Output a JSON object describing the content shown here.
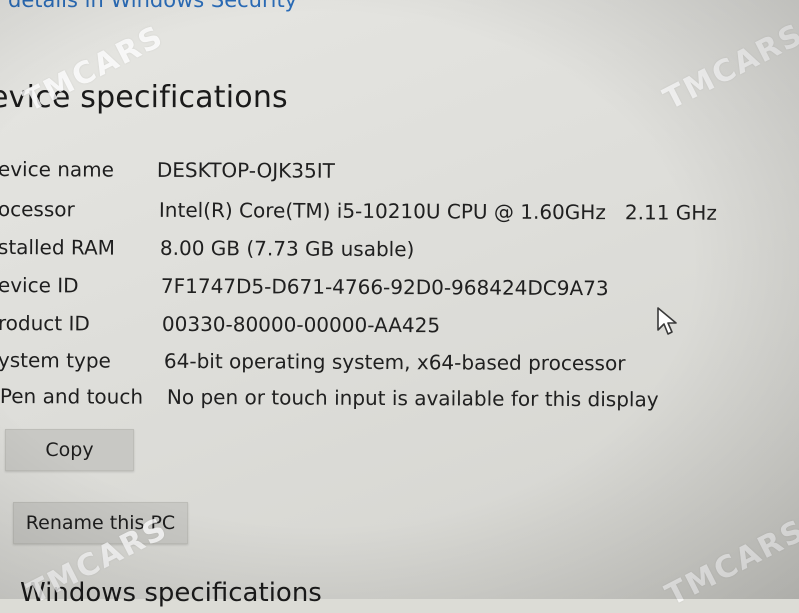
{
  "header": {
    "security_link": "details in Windows Security",
    "section_title": "evice specifications",
    "next_section_title": "Windows specifications"
  },
  "specs": [
    {
      "label": "evice name",
      "value": "DESKTOP-OJK35IT"
    },
    {
      "label": "ocessor",
      "value": "Intel(R) Core(TM) i5-10210U CPU @ 1.60GHz   2.11 GHz"
    },
    {
      "label": "stalled RAM",
      "value": "8.00 GB (7.73 GB usable)"
    },
    {
      "label": "evice ID",
      "value": "7F1747D5-D671-4766-92D0-968424DC9A73"
    },
    {
      "label": "roduct ID",
      "value": "00330-80000-00000-AA425"
    },
    {
      "label": "ystem type",
      "value": "64-bit operating system, x64-based processor"
    },
    {
      "label": "Pen and touch",
      "value": "No pen or touch input is available for this display"
    }
  ],
  "buttons": {
    "copy_label": "Copy",
    "rename_label": "Rename this PC"
  },
  "watermark": {
    "text": "TMCARS"
  },
  "icons": {
    "cursor": "mouse-pointer-icon"
  },
  "colors": {
    "link": "#2a6bb6",
    "background": "#e2e2de",
    "button": "#c8c8c4"
  }
}
